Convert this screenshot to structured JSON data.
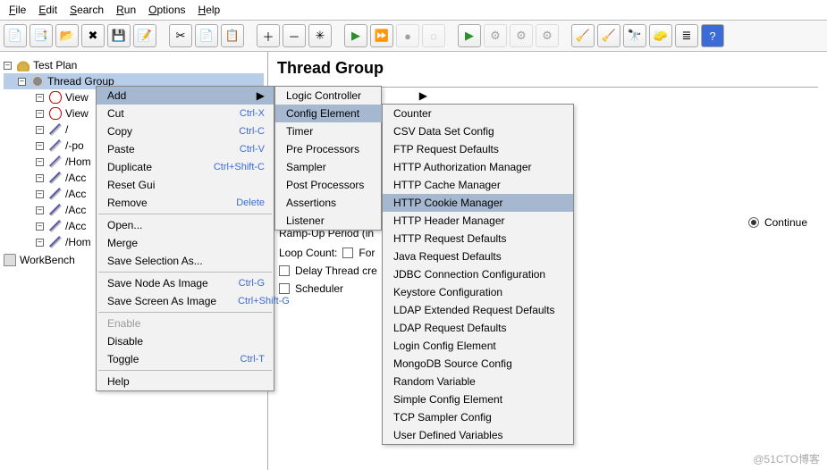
{
  "menubar": {
    "items": [
      "File",
      "Edit",
      "Search",
      "Run",
      "Options",
      "Help"
    ]
  },
  "toolbar": {
    "buttons": [
      {
        "name": "new-icon",
        "glyph": "📄"
      },
      {
        "name": "templates-icon",
        "glyph": "📑"
      },
      {
        "name": "open-icon",
        "glyph": "📂"
      },
      {
        "name": "close-icon",
        "glyph": "✖"
      },
      {
        "name": "save-icon",
        "glyph": "💾"
      },
      {
        "name": "save-as-icon",
        "glyph": "📝"
      },
      {
        "sep": true
      },
      {
        "name": "cut-icon",
        "glyph": "✂"
      },
      {
        "name": "copy-icon",
        "glyph": "📄"
      },
      {
        "name": "paste-icon",
        "glyph": "📋"
      },
      {
        "sep": true
      },
      {
        "name": "expand-icon",
        "glyph": "＋"
      },
      {
        "name": "collapse-icon",
        "glyph": "－"
      },
      {
        "name": "toggle-icon",
        "glyph": "✳"
      },
      {
        "sep": true
      },
      {
        "name": "start-icon",
        "glyph": "▶",
        "color": "#2a8f2a"
      },
      {
        "name": "start-no-timers-icon",
        "glyph": "⏩",
        "color": "#2a8f2a"
      },
      {
        "name": "stop-icon",
        "glyph": "●",
        "disabled": true
      },
      {
        "name": "shutdown-icon",
        "glyph": "◌",
        "disabled": true
      },
      {
        "sep": true
      },
      {
        "name": "remote-start-icon",
        "glyph": "▶",
        "color": "#2a8f2a"
      },
      {
        "name": "remote-start-all-icon",
        "glyph": "⚙",
        "disabled": true
      },
      {
        "name": "remote-stop-icon",
        "glyph": "⚙",
        "disabled": true
      },
      {
        "name": "remote-shutdown-icon",
        "glyph": "⚙",
        "disabled": true
      },
      {
        "sep": true
      },
      {
        "name": "clear-icon",
        "glyph": "🧹"
      },
      {
        "name": "clear-all-icon",
        "glyph": "🧹"
      },
      {
        "name": "search-icon",
        "glyph": "🔭"
      },
      {
        "name": "reset-search-icon",
        "glyph": "🧽"
      },
      {
        "name": "function-helper-icon",
        "glyph": "≣"
      },
      {
        "name": "help-icon",
        "glyph": "?",
        "bg": "#3a6bd6"
      }
    ]
  },
  "tree": {
    "test_plan": "Test Plan",
    "thread_group": "Thread Group",
    "children": [
      {
        "icon": "eye",
        "label": "View"
      },
      {
        "icon": "eye",
        "label": "View"
      },
      {
        "icon": "pen",
        "label": "/"
      },
      {
        "icon": "pen",
        "label": "/-po"
      },
      {
        "icon": "pen",
        "label": "/Hom"
      },
      {
        "icon": "pen",
        "label": "/Acc"
      },
      {
        "icon": "pen",
        "label": "/Acc"
      },
      {
        "icon": "pen",
        "label": "/Acc"
      },
      {
        "icon": "pen",
        "label": "/Acc"
      },
      {
        "icon": "pen",
        "label": "/Hom"
      }
    ],
    "workbench": "WorkBench"
  },
  "context_menu": {
    "items": [
      {
        "label": "Add",
        "shortcut": "",
        "arrow": true,
        "highlight": true
      },
      {
        "label": "Cut",
        "shortcut": "Ctrl-X"
      },
      {
        "label": "Copy",
        "shortcut": "Ctrl-C"
      },
      {
        "label": "Paste",
        "shortcut": "Ctrl-V"
      },
      {
        "label": "Duplicate",
        "shortcut": "Ctrl+Shift-C"
      },
      {
        "label": "Reset Gui",
        "shortcut": ""
      },
      {
        "label": "Remove",
        "shortcut": "Delete"
      },
      {
        "sep": true
      },
      {
        "label": "Open...",
        "shortcut": ""
      },
      {
        "label": "Merge",
        "shortcut": ""
      },
      {
        "label": "Save Selection As...",
        "shortcut": ""
      },
      {
        "sep": true
      },
      {
        "label": "Save Node As Image",
        "shortcut": "Ctrl-G"
      },
      {
        "label": "Save Screen As Image",
        "shortcut": "Ctrl+Shift-G"
      },
      {
        "sep": true
      },
      {
        "label": "Enable",
        "shortcut": "",
        "disabled": true
      },
      {
        "label": "Disable",
        "shortcut": ""
      },
      {
        "label": "Toggle",
        "shortcut": "Ctrl-T"
      },
      {
        "sep": true
      },
      {
        "label": "Help",
        "shortcut": ""
      }
    ]
  },
  "add_submenu": {
    "items": [
      {
        "label": "Logic Controller",
        "arrow": true
      },
      {
        "label": "Config Element",
        "arrow": true,
        "highlight": true
      },
      {
        "label": "Timer",
        "arrow": true
      },
      {
        "label": "Pre Processors",
        "arrow": true
      },
      {
        "label": "Sampler",
        "arrow": true
      },
      {
        "label": "Post Processors",
        "arrow": true
      },
      {
        "label": "Assertions",
        "arrow": true
      },
      {
        "label": "Listener",
        "arrow": true
      }
    ]
  },
  "config_submenu": {
    "items": [
      "Counter",
      "CSV Data Set Config",
      "FTP Request Defaults",
      "HTTP Authorization Manager",
      "HTTP Cache Manager",
      "HTTP Cookie Manager",
      "HTTP Header Manager",
      "HTTP Request Defaults",
      "Java Request Defaults",
      "JDBC Connection Configuration",
      "Keystore Configuration",
      "LDAP Extended Request Defaults",
      "LDAP Request Defaults",
      "Login Config Element",
      "MongoDB Source Config",
      "Random Variable",
      "Simple Config Element",
      "TCP Sampler Config",
      "User Defined Variables"
    ],
    "highlight_index": 5
  },
  "panel": {
    "title": "Thread Group",
    "ramp_up_label_partial": "Ramp-Up Period (in",
    "loop_count_label": "Loop Count:",
    "forever_label": "For",
    "delay_label": "Delay Thread cre",
    "scheduler_label": "Scheduler",
    "continue_label": "Continue"
  },
  "watermark": "@51CTO博客"
}
